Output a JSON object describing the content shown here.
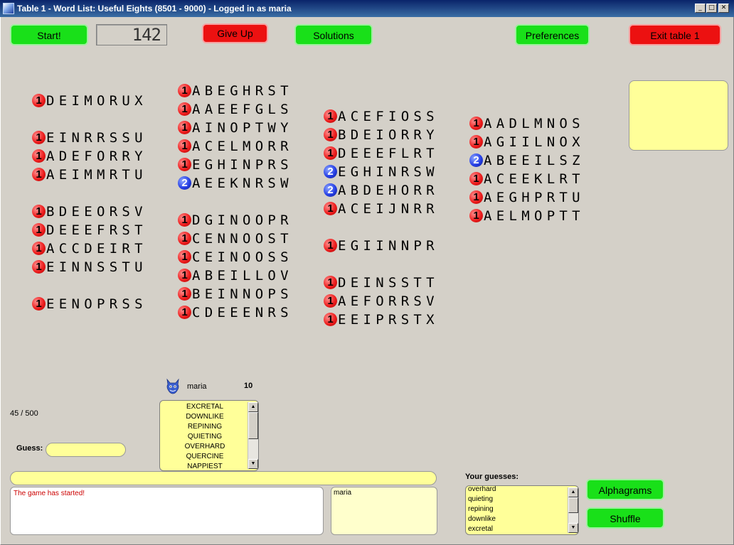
{
  "window": {
    "title": "Table 1 - Word List: Useful Eights (8501 - 9000) - Logged in as maria",
    "minimize": "_",
    "maximize": "□",
    "close": "✕"
  },
  "toolbar": {
    "start": "Start!",
    "timer": "142",
    "give_up": "Give Up",
    "solutions": "Solutions",
    "preferences": "Preferences",
    "exit": "Exit table 1"
  },
  "colors": {
    "green_button": "#19e019",
    "red_button": "#ec1111",
    "yellow_field": "#ffff99",
    "red_badge": "#ee1e1e",
    "blue_badge": "#2740e6"
  },
  "board": [
    {
      "count": "1",
      "letters": "DEIMORUX",
      "color": "red"
    },
    {
      "count": "1",
      "letters": "EINRRSSU",
      "color": "red"
    },
    {
      "count": "1",
      "letters": "ADEFORRY",
      "color": "red"
    },
    {
      "count": "1",
      "letters": "AEIMMRTU",
      "color": "red"
    },
    {
      "count": "1",
      "letters": "BDEEORSV",
      "color": "red"
    },
    {
      "count": "1",
      "letters": "DEEEFRST",
      "color": "red"
    },
    {
      "count": "1",
      "letters": "ACCDEIRT",
      "color": "red"
    },
    {
      "count": "1",
      "letters": "EINNSSTU",
      "color": "red"
    },
    {
      "count": "1",
      "letters": "EENOPRSS",
      "color": "red"
    },
    {
      "count": "1",
      "letters": "ABEGHRST",
      "color": "red"
    },
    {
      "count": "1",
      "letters": "AAEEFGLS",
      "color": "red"
    },
    {
      "count": "1",
      "letters": "AINOPTWY",
      "color": "red"
    },
    {
      "count": "1",
      "letters": "ACELMORR",
      "color": "red"
    },
    {
      "count": "1",
      "letters": "EGHINPRS",
      "color": "red"
    },
    {
      "count": "2",
      "letters": "AEEKNRSW",
      "color": "blue"
    },
    {
      "count": "1",
      "letters": "DGINOOPR",
      "color": "red"
    },
    {
      "count": "1",
      "letters": "CENNOOST",
      "color": "red"
    },
    {
      "count": "1",
      "letters": "CEINOOSS",
      "color": "red"
    },
    {
      "count": "1",
      "letters": "ABEILLOV",
      "color": "red"
    },
    {
      "count": "1",
      "letters": "BEINNOPS",
      "color": "red"
    },
    {
      "count": "1",
      "letters": "CDEEENRS",
      "color": "red"
    },
    {
      "count": "1",
      "letters": "ACEFIOSS",
      "color": "red"
    },
    {
      "count": "1",
      "letters": "BDEIORRY",
      "color": "red"
    },
    {
      "count": "1",
      "letters": "DEEEFLRT",
      "color": "red"
    },
    {
      "count": "2",
      "letters": "EGHINRSW",
      "color": "blue"
    },
    {
      "count": "2",
      "letters": "ABDEHORR",
      "color": "blue"
    },
    {
      "count": "1",
      "letters": "ACEIJNRR",
      "color": "red"
    },
    {
      "count": "1",
      "letters": "EGIINNPR",
      "color": "red"
    },
    {
      "count": "1",
      "letters": "DEINSSTT",
      "color": "red"
    },
    {
      "count": "1",
      "letters": "AEFORRSV",
      "color": "red"
    },
    {
      "count": "1",
      "letters": "EEIPRSTX",
      "color": "red"
    },
    {
      "count": "1",
      "letters": "AADLMNOS",
      "color": "red"
    },
    {
      "count": "1",
      "letters": "AGIILNOX",
      "color": "red"
    },
    {
      "count": "2",
      "letters": "ABEEILSZ",
      "color": "blue"
    },
    {
      "count": "1",
      "letters": "ACEEKLRT",
      "color": "red"
    },
    {
      "count": "1",
      "letters": "AEGHPRTU",
      "color": "red"
    },
    {
      "count": "1",
      "letters": "AELMOPTT",
      "color": "red"
    }
  ],
  "player": {
    "name": "maria",
    "score": "10",
    "avatar_icon": "devil-avatar-icon"
  },
  "progress": "45 / 500",
  "guess": {
    "label": "Guess:",
    "value": ""
  },
  "player_words": [
    "EXCRETAL",
    "DOWNLIKE",
    "REPINING",
    "QUIETING",
    "OVERHARD",
    "QUERCINE",
    "NAPPIEST"
  ],
  "chat": {
    "input_value": "",
    "log": "The game has started!"
  },
  "users": [
    "maria"
  ],
  "your_guesses": {
    "label": "Your guesses:",
    "items": [
      "overhard",
      "quieting",
      "repining",
      "downlike",
      "excretal"
    ]
  },
  "side_buttons": {
    "alphagrams": "Alphagrams",
    "shuffle": "Shuffle"
  }
}
